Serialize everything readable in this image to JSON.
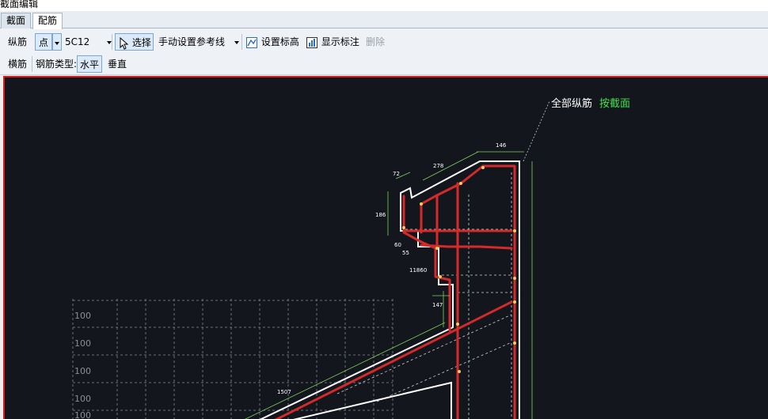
{
  "window": {
    "title": "截面编辑"
  },
  "tabs": [
    {
      "label": "截面",
      "active": false
    },
    {
      "label": "配筋",
      "active": true
    }
  ],
  "toolbar1": {
    "longitudinal_label": "纵筋",
    "point_mode": "点",
    "rebar_spec": "5C12",
    "select_label": "选择",
    "ref_line_label": "手动设置参考线",
    "set_elevation_label": "设置标高",
    "show_dimension_label": "显示标注",
    "delete_label": "删除"
  },
  "toolbar2": {
    "transverse_label": "横筋",
    "rebar_type_label": "钢筋类型:",
    "horizontal_label": "水平",
    "vertical_label": "垂直"
  },
  "canvas": {
    "annotation_prefix": "全部纵筋",
    "annotation_link": "按截面",
    "dimensions": [
      "146",
      "278",
      "72",
      "186",
      "60",
      "55",
      "11860",
      "147",
      "1507"
    ],
    "grid_labels": [
      "100",
      "100",
      "100",
      "100",
      "100"
    ],
    "colors": {
      "background": "#13161d",
      "section_outline": "#ffffff",
      "rebar": "#d42a2a",
      "dimension": "#7fd15a",
      "grid": "#6b6f77",
      "annotation_link": "#3ee04b"
    }
  }
}
